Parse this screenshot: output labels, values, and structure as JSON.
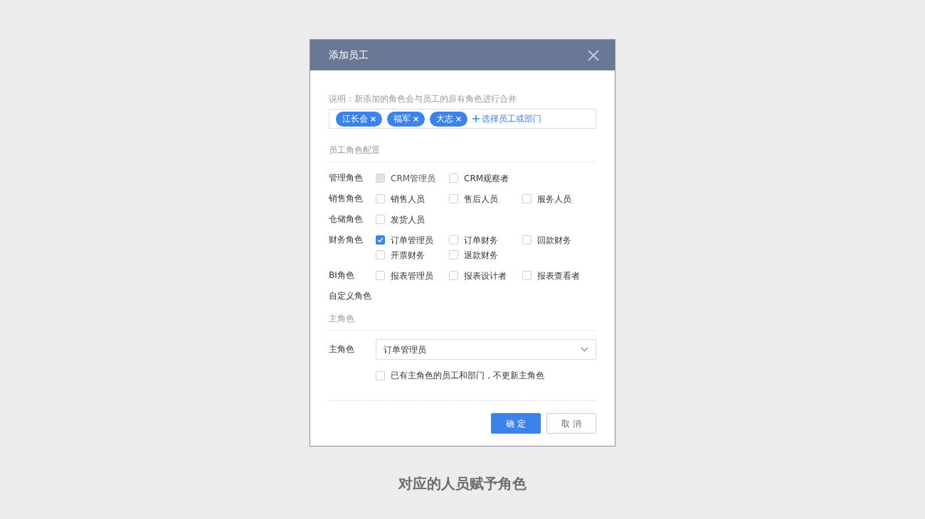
{
  "dialog": {
    "title": "添加员工",
    "note": "说明：新添加的角色会与员工的原有角色进行合并",
    "recipients": [
      {
        "label": "江长会"
      },
      {
        "label": "福军"
      },
      {
        "label": "大志"
      }
    ],
    "add_link": "选择员工或部门",
    "role_section": "员工角色配置",
    "role_groups": [
      {
        "label": "管理角色",
        "options": [
          {
            "label": "CRM管理员",
            "checked": false,
            "disabled": true
          },
          {
            "label": "CRM观察者",
            "checked": false,
            "disabled": false
          }
        ]
      },
      {
        "label": "销售角色",
        "options": [
          {
            "label": "销售人员",
            "checked": false,
            "disabled": false
          },
          {
            "label": "售后人员",
            "checked": false,
            "disabled": false
          },
          {
            "label": "服务人员",
            "checked": false,
            "disabled": false
          }
        ]
      },
      {
        "label": "仓储角色",
        "options": [
          {
            "label": "发货人员",
            "checked": false,
            "disabled": false
          }
        ]
      },
      {
        "label": "财务角色",
        "options": [
          {
            "label": "订单管理员",
            "checked": true,
            "disabled": false
          },
          {
            "label": "订单财务",
            "checked": false,
            "disabled": false
          },
          {
            "label": "回款财务",
            "checked": false,
            "disabled": false
          },
          {
            "label": "开票财务",
            "checked": false,
            "disabled": false
          },
          {
            "label": "退款财务",
            "checked": false,
            "disabled": false
          }
        ]
      },
      {
        "label": "BI角色",
        "options": [
          {
            "label": "报表管理员",
            "checked": false,
            "disabled": false
          },
          {
            "label": "报表设计者",
            "checked": false,
            "disabled": false
          },
          {
            "label": "报表查看者",
            "checked": false,
            "disabled": false
          }
        ]
      },
      {
        "label": "自定义角色"
      }
    ],
    "primary_section": "主角色",
    "primary_role": {
      "label": "主角色",
      "value": "订单管理员"
    },
    "keep_option": {
      "label": "已有主角色的员工和部门，不更新主角色",
      "checked": false
    },
    "buttons": [
      {
        "label": "确定",
        "kind": "primary"
      },
      {
        "label": "取消",
        "kind": "secondary"
      }
    ]
  },
  "caption": "对应的人员赋予角色"
}
